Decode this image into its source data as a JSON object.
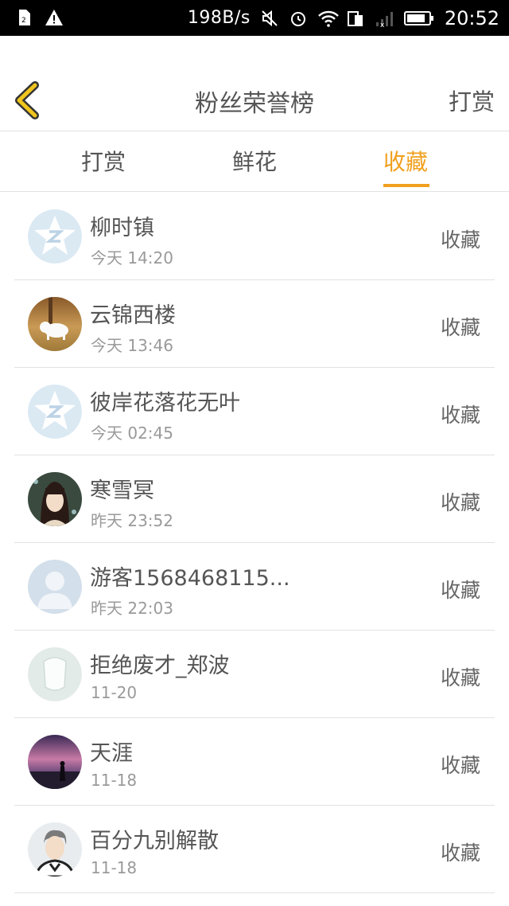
{
  "status_bar": {
    "network_speed": "198B/s",
    "time": "20:52"
  },
  "header": {
    "title": "粉丝荣誉榜",
    "action_label": "打赏",
    "back_icon": "chevron-left-icon",
    "accent_color": "#f0c51e"
  },
  "tabs": [
    {
      "label": "打赏",
      "active": false
    },
    {
      "label": "鲜花",
      "active": false
    },
    {
      "label": "收藏",
      "active": true
    }
  ],
  "active_color": "#f0a01e",
  "fans": [
    {
      "name": "柳时镇",
      "time": "今天 14:20",
      "action": "收藏",
      "avatar": "qq-star-avatar"
    },
    {
      "name": "云锦西楼",
      "time": "今天 13:46",
      "action": "收藏",
      "avatar": "white-cat-photo"
    },
    {
      "name": "彼岸花落花无叶",
      "time": "今天 02:45",
      "action": "收藏",
      "avatar": "qq-star-avatar"
    },
    {
      "name": "寒雪冥",
      "time": "昨天 23:52",
      "action": "收藏",
      "avatar": "anime-girl-avatar"
    },
    {
      "name": "游客1568468115...",
      "time": "昨天 22:03",
      "action": "收藏",
      "avatar": "default-person-avatar"
    },
    {
      "name": "拒绝废才_郑波",
      "time": "11-20",
      "action": "收藏",
      "avatar": "blank-head-avatar"
    },
    {
      "name": "天涯",
      "time": "11-18",
      "action": "收藏",
      "avatar": "sunset-silhouette-photo"
    },
    {
      "name": "百分九别解散",
      "time": "11-18",
      "action": "收藏",
      "avatar": "young-man-photo"
    }
  ]
}
